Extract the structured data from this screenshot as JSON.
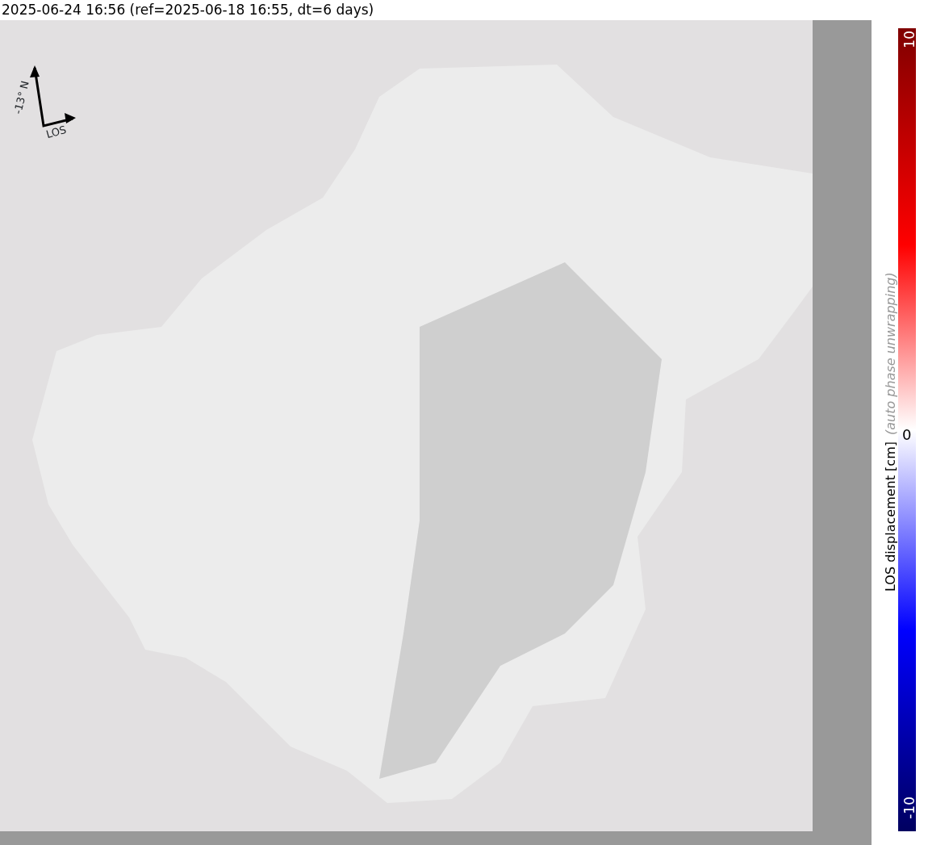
{
  "title": "2025-06-24 16:56 (ref=2025-06-18 16:55, dt=6 days)",
  "orientation": {
    "heading_label": "-13° N",
    "los_label": "LOS"
  },
  "colorbar": {
    "label": "LOS displacement [cm]",
    "note": "(auto phase unwrapping)",
    "max_label": "10",
    "mid_label": "0",
    "min_label": "-10"
  }
}
